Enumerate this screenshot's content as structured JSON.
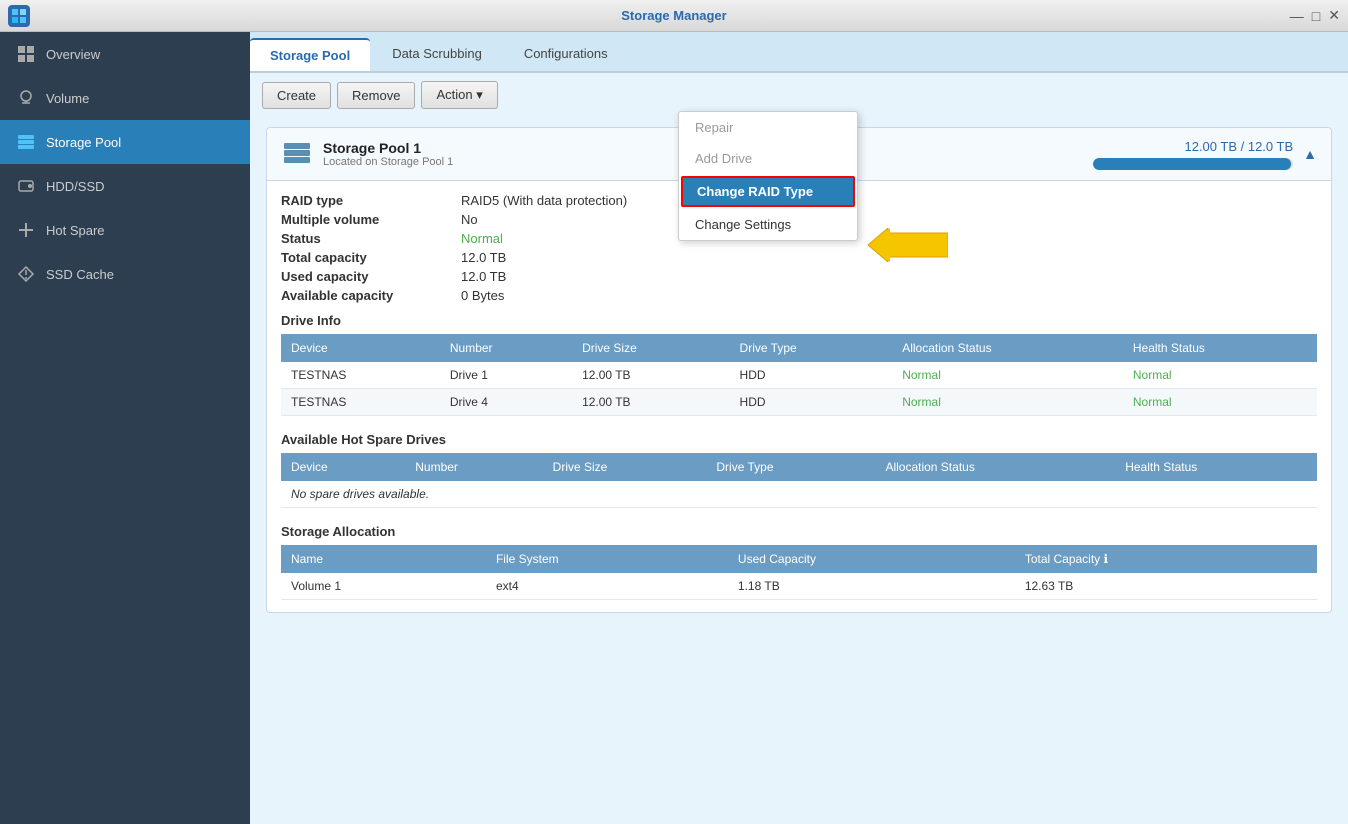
{
  "titleBar": {
    "title": "Storage Manager",
    "controls": [
      "—",
      "□",
      "✕"
    ]
  },
  "sidebar": {
    "items": [
      {
        "id": "overview",
        "label": "Overview",
        "icon": "grid-icon",
        "active": false
      },
      {
        "id": "volume",
        "label": "Volume",
        "icon": "volume-icon",
        "active": false
      },
      {
        "id": "storage-pool",
        "label": "Storage Pool",
        "icon": "storage-pool-icon",
        "active": true
      },
      {
        "id": "hdd-ssd",
        "label": "HDD/SSD",
        "icon": "hdd-icon",
        "active": false
      },
      {
        "id": "hot-spare",
        "label": "Hot Spare",
        "icon": "hot-spare-icon",
        "active": false
      },
      {
        "id": "ssd-cache",
        "label": "SSD Cache",
        "icon": "ssd-cache-icon",
        "active": false
      }
    ]
  },
  "tabs": [
    {
      "id": "storage-pool",
      "label": "Storage Pool",
      "active": true
    },
    {
      "id": "data-scrubbing",
      "label": "Data Scrubbing",
      "active": false
    },
    {
      "id": "configurations",
      "label": "Configurations",
      "active": false
    }
  ],
  "toolbar": {
    "create_label": "Create",
    "remove_label": "Remove",
    "action_label": "Action ▾"
  },
  "dropdown": {
    "items": [
      {
        "id": "repair",
        "label": "Repair",
        "disabled": true
      },
      {
        "id": "add-drive",
        "label": "Add Drive",
        "disabled": true
      },
      {
        "id": "change-raid-type",
        "label": "Change RAID Type",
        "highlighted": true
      },
      {
        "id": "change-settings",
        "label": "Change Settings",
        "disabled": false
      }
    ]
  },
  "poolCard": {
    "name": "Storage Pool 1",
    "location": "Located on Storage Pool 1",
    "capacityText": "12.00 TB / 12.0  TB",
    "capacityPercent": 99,
    "details": {
      "raidType": {
        "label": "RAID type",
        "value": "RAID5  (With data protection)"
      },
      "multipleVolume": {
        "label": "Multiple volume",
        "value": "No"
      },
      "status": {
        "label": "Status",
        "value": "Normal",
        "isStatus": true
      },
      "totalCapacity": {
        "label": "Total capacity",
        "value": "12.0  TB"
      },
      "usedCapacity": {
        "label": "Used capacity",
        "value": "12.0  TB"
      },
      "availableCapacity": {
        "label": "Available capacity",
        "value": "0 Bytes"
      }
    },
    "driveInfo": {
      "title": "Drive Info",
      "columns": [
        "Device",
        "Number",
        "Drive Size",
        "Drive Type",
        "Allocation Status",
        "Health Status"
      ],
      "rows": [
        {
          "device": "TESTNAS",
          "number": "Drive 1",
          "size": "12.00 TB",
          "type": "HDD",
          "allocation": "Normal",
          "health": "Normal"
        },
        {
          "device": "TESTNAS",
          "number": "Drive 4",
          "size": "12.00 TB",
          "type": "HDD",
          "allocation": "Normal",
          "health": "Normal"
        }
      ]
    },
    "hotSpare": {
      "title": "Available Hot Spare Drives",
      "columns": [
        "Device",
        "Number",
        "Drive Size",
        "Drive Type",
        "Allocation Status",
        "Health Status"
      ],
      "noDataMessage": "No spare drives available."
    },
    "storageAllocation": {
      "title": "Storage Allocation",
      "columns": [
        "Name",
        "File System",
        "Used Capacity",
        "Total Capacity ℹ"
      ],
      "rows": [
        {
          "name": "Volume 1",
          "fileSystem": "ext4",
          "usedCapacity": "1.18 TB",
          "totalCapacity": "12.63 TB"
        }
      ]
    }
  }
}
